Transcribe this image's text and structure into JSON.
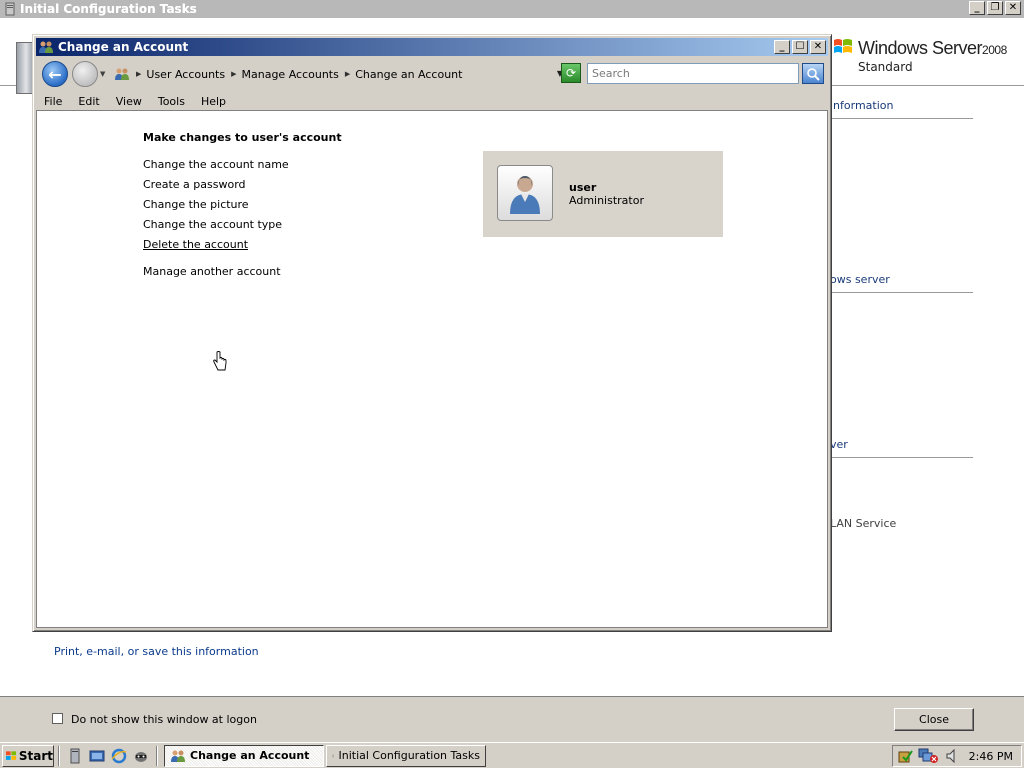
{
  "bg_window": {
    "title": "Initial Configuration Tasks",
    "logo_name": "Windows Server",
    "logo_version": "2008",
    "logo_edition": "Standard",
    "sections": [
      "information",
      "ows server",
      "ver"
    ],
    "service_fragment": "LAN Service",
    "print_link": "Print, e-mail, or save this information",
    "dont_show_label": "Do not show this window at logon",
    "dont_show_checked": false,
    "close_label": "Close"
  },
  "window": {
    "title": "Change an Account",
    "breadcrumb": [
      "User Accounts",
      "Manage Accounts",
      "Change an Account"
    ],
    "search_placeholder": "Search",
    "menu": [
      "File",
      "Edit",
      "View",
      "Tools",
      "Help"
    ]
  },
  "content": {
    "heading": "Make changes to user's account",
    "tasks": [
      "Change the account name",
      "Create a password",
      "Change the picture",
      "Change the account type",
      "Delete the account"
    ],
    "other_task": "Manage another account",
    "user": {
      "name": "user",
      "role": "Administrator"
    }
  },
  "taskbar": {
    "start_label": "Start",
    "quick_launch_icons": [
      "server-manager-icon",
      "show-desktop-icon",
      "internet-explorer-icon",
      "raccoon-icon"
    ],
    "tasks": [
      {
        "label": "Change an Account",
        "active": true
      },
      {
        "label": "Initial Configuration Tasks",
        "active": false
      }
    ],
    "clock": "2:46 PM"
  }
}
